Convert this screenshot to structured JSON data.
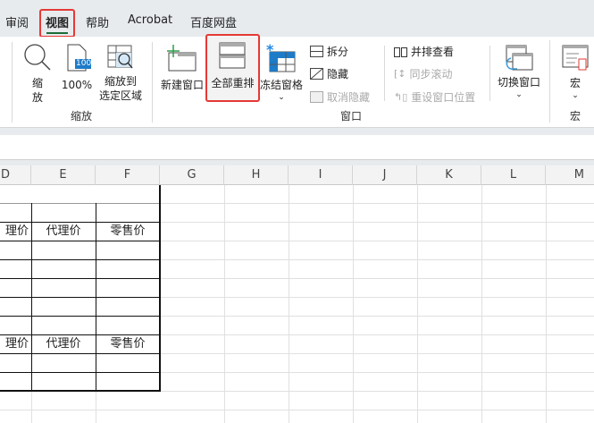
{
  "tabs": [
    {
      "label": "审阅"
    },
    {
      "label": "视图",
      "active": true
    },
    {
      "label": "帮助"
    },
    {
      "label": "Acrobat"
    },
    {
      "label": "百度网盘"
    }
  ],
  "ribbon": {
    "zoom_group": {
      "label": "缩放",
      "zoom": "缩\n放",
      "zoom100": "100%",
      "zoom100_badge": "100",
      "zoom_selection_1": "缩放到",
      "zoom_selection_2": "选定区域"
    },
    "window_group": {
      "label": "窗口",
      "new_window": "新建窗口",
      "arrange_all": "全部重排",
      "freeze_panes": "冻结窗格",
      "split": "拆分",
      "hide": "隐藏",
      "unhide": "取消隐藏",
      "side_by_side": "并排查看",
      "sync_scroll": "同步滚动",
      "reset_position": "重设窗口位置",
      "switch_windows": "切换窗口"
    },
    "macro_group": {
      "label": "宏",
      "macros": "宏"
    }
  },
  "highlight_color": "#e53935",
  "columns": [
    "D",
    "E",
    "F",
    "G",
    "H",
    "I",
    "J",
    "K",
    "L",
    "M"
  ],
  "cells": {
    "row3": [
      "理价",
      "代理价",
      "零售价"
    ],
    "row9": [
      "理价",
      "代理价",
      "零售价"
    ]
  }
}
